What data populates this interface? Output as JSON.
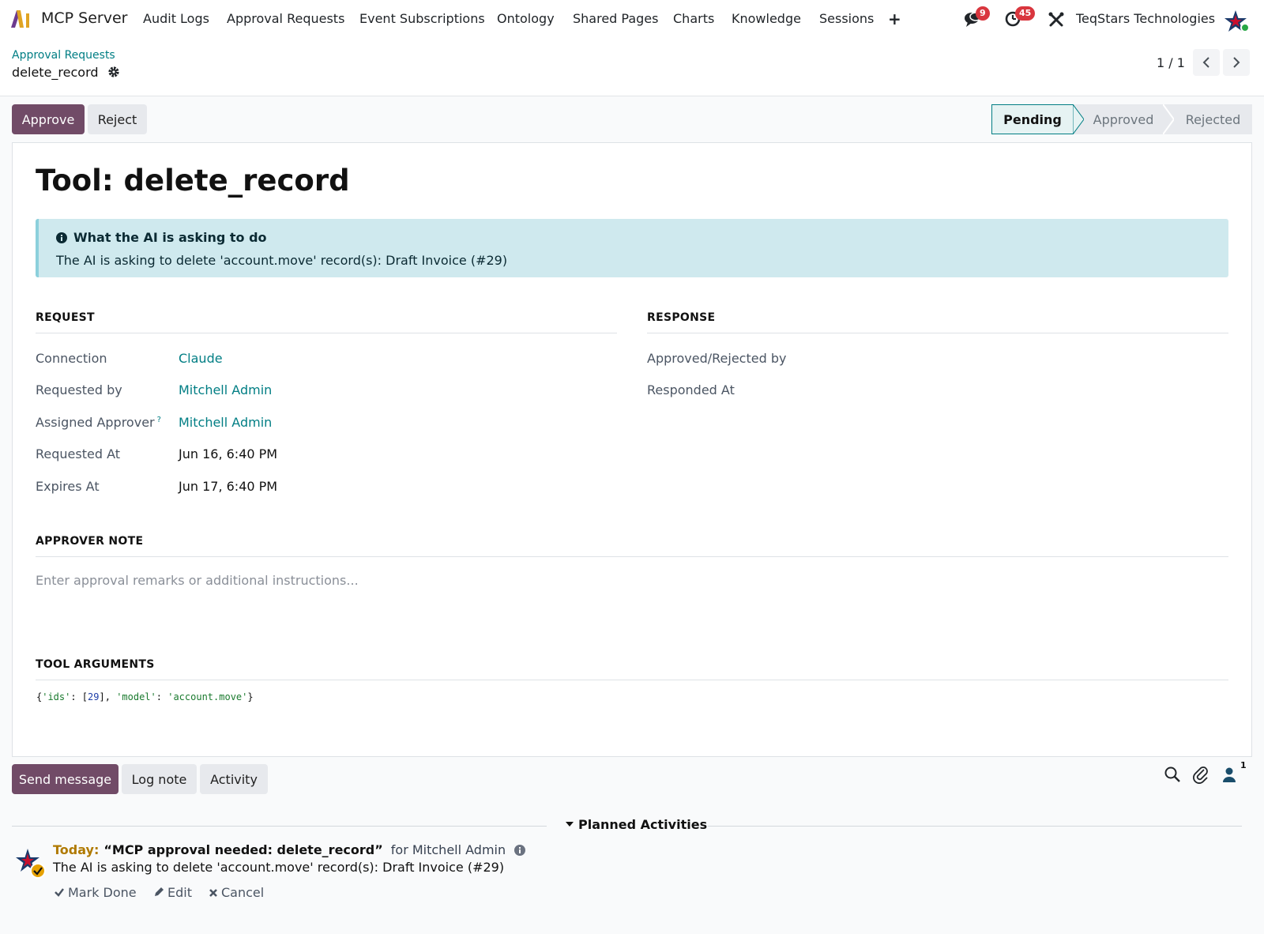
{
  "app": {
    "name": "MCP Server",
    "company": "TeqStars Technologies"
  },
  "nav": {
    "items": [
      "Audit Logs",
      "Approval Requests",
      "Event Subscriptions",
      "Ontology",
      "Shared Pages",
      "Charts",
      "Knowledge",
      "Sessions"
    ],
    "messages_count": "9",
    "activities_count": "45"
  },
  "breadcrumb": {
    "parent": "Approval Requests",
    "current": "delete_record"
  },
  "pager": {
    "value": "1 / 1"
  },
  "actions": {
    "approve": "Approve",
    "reject": "Reject"
  },
  "statusbar": {
    "steps": [
      "Pending",
      "Approved",
      "Rejected"
    ],
    "active": "Pending"
  },
  "form": {
    "title": "Tool: delete_record",
    "alert": {
      "heading": "What the AI is asking to do",
      "body": "The AI is asking to delete 'account.move' record(s): Draft Invoice (#29)"
    },
    "request": {
      "section_title": "REQUEST",
      "fields": [
        {
          "label": "Connection",
          "value": "Claude",
          "link": true
        },
        {
          "label": "Requested by",
          "value": "Mitchell Admin",
          "link": true
        },
        {
          "label": "Assigned Approver",
          "value": "Mitchell Admin",
          "link": true,
          "help": "?"
        },
        {
          "label": "Requested At",
          "value": "Jun 16, 6:40 PM",
          "link": false
        },
        {
          "label": "Expires At",
          "value": "Jun 17, 6:40 PM",
          "link": false
        }
      ]
    },
    "response": {
      "section_title": "RESPONSE",
      "fields": [
        {
          "label": "Approved/Rejected by",
          "value": ""
        },
        {
          "label": "Responded At",
          "value": ""
        }
      ]
    },
    "approver_note": {
      "section_title": "APPROVER NOTE",
      "value": "",
      "placeholder": "Enter approval remarks or additional instructions..."
    },
    "tool_arguments": {
      "section_title": "TOOL ARGUMENTS",
      "open": "{",
      "key_ids": "'ids'",
      "sep1": ": [",
      "ids_value": "29",
      "sep2": "], ",
      "key_model": "'model'",
      "sep3": ": ",
      "model_value": "'account.move'",
      "close": "}"
    }
  },
  "chatter": {
    "send_message": "Send message",
    "log_note": "Log note",
    "activity": "Activity",
    "followers_count": "1",
    "planned_activities_title": "Planned Activities",
    "activity_item": {
      "due": "Today:",
      "summary": "“MCP approval needed: delete_record”",
      "assignee": "for Mitchell Admin",
      "note": "The AI is asking to delete 'account.move' record(s): Draft Invoice (#29)",
      "mark_done": "Mark Done",
      "edit": "Edit",
      "cancel": "Cancel"
    }
  },
  "colors": {
    "primary": "#714b67",
    "link": "#017e84",
    "alert_bg": "#cfe9ee",
    "badge": "#d9363e",
    "today": "#b07a00"
  }
}
